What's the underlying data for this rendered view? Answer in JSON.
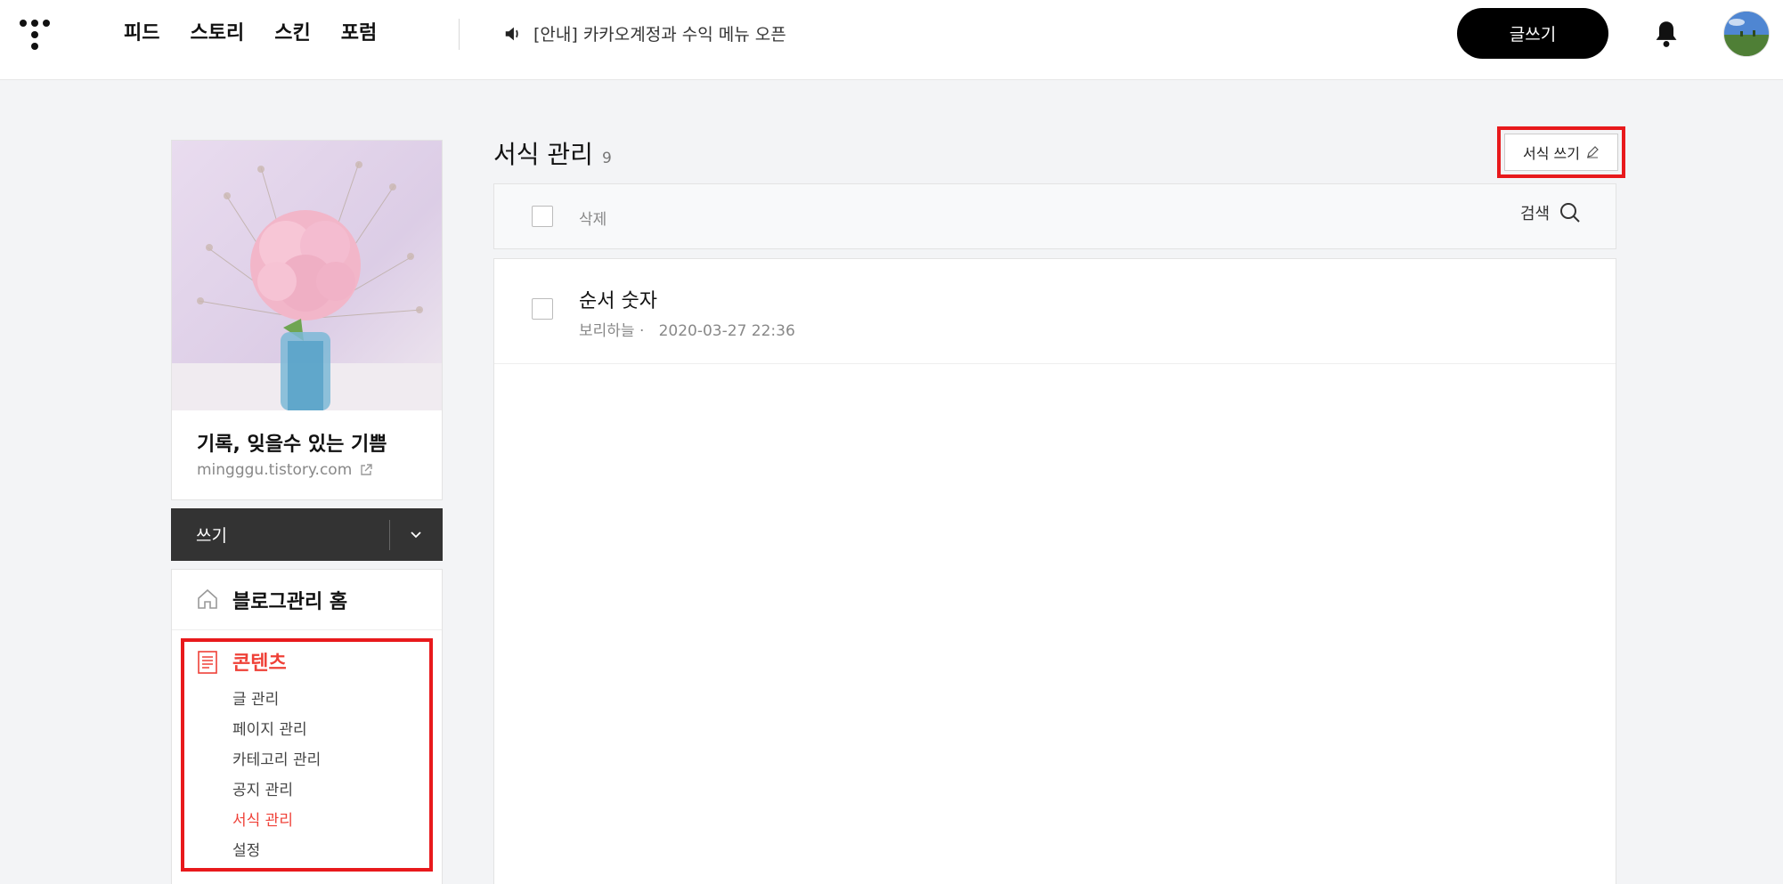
{
  "nav": {
    "items": [
      "피드",
      "스토리",
      "스킨",
      "포럼"
    ],
    "notice": "[안내] 카카오계정과 수익 메뉴 오픈",
    "write_button": "글쓰기"
  },
  "blog": {
    "title": "기록, 잊을수 있는 기쁨",
    "url": "mingggu.tistory.com"
  },
  "sidebar": {
    "write_label": "쓰기",
    "home_label": "블로그관리 홈",
    "content_label": "콘텐츠",
    "content_items": [
      "글 관리",
      "페이지 관리",
      "카테고리 관리",
      "공지 관리",
      "서식 관리",
      "설정"
    ],
    "active_item": "서식 관리"
  },
  "main": {
    "title": "서식 관리",
    "count": "9",
    "add_button": "서식 쓰기",
    "toolbar": {
      "delete_label": "삭제",
      "search_label": "검색"
    },
    "rows": [
      {
        "title": "순서 숫자",
        "author": "보리하늘",
        "date": "2020-03-27 22:36"
      }
    ]
  },
  "colors": {
    "accent": "#ef4138",
    "highlight_border": "#e8191c",
    "write_bar": "#333333",
    "background": "#f3f4f6"
  },
  "icons": {
    "logo": "tistory-logo-icon",
    "notice": "speaker-icon",
    "bell": "bell-icon",
    "external": "external-link-icon",
    "dropdown": "chevron-down-icon",
    "home": "home-icon",
    "content": "document-icon",
    "edit": "pencil-icon",
    "search": "search-icon"
  }
}
